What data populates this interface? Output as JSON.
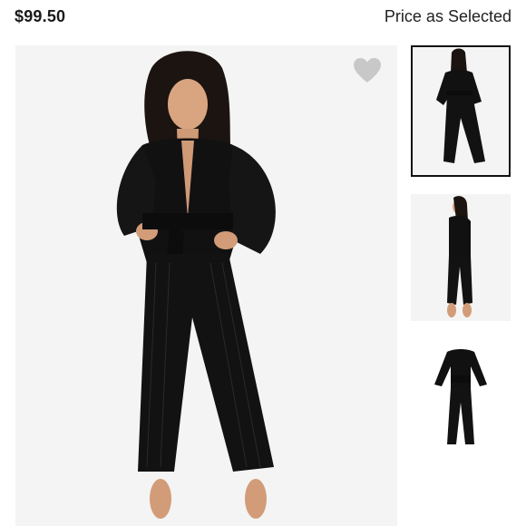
{
  "product": {
    "price": "$99.50",
    "price_note": "Price as Selected"
  },
  "icons": {
    "favorite": "heart-icon"
  },
  "colors": {
    "garment": "#111111",
    "heart": "#c8c8c8",
    "selected_outline": "#111111"
  }
}
